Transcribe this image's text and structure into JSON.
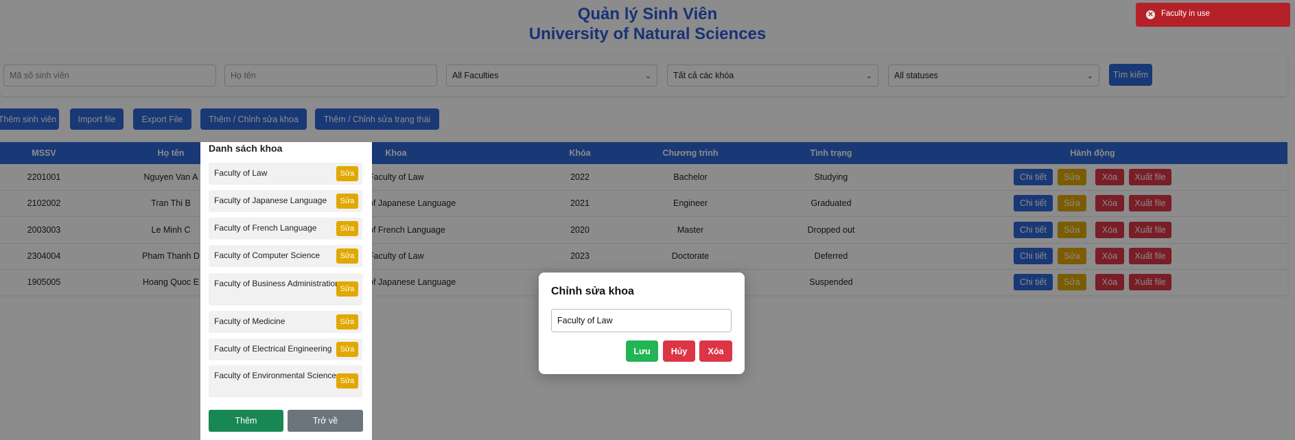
{
  "header": {
    "title_line1": "Quản lý Sinh Viên",
    "title_line2": "University of Natural Sciences"
  },
  "filters": {
    "student_id_placeholder": "Mã số sinh viên",
    "name_placeholder": "Họ tên",
    "faculty_selected": "All Faculties",
    "course_selected": "Tất cả các khóa",
    "status_selected": "All statuses",
    "search_label": "Tìm kiếm"
  },
  "toolbar": {
    "add_student": "Thêm sinh viên",
    "import_file": "Import file",
    "export_file": "Export File",
    "edit_faculty": "Thêm / Chỉnh sửa khoa",
    "edit_status": "Thêm / Chỉnh sửa trạng thái"
  },
  "table": {
    "headers": {
      "mssv": "MSSV",
      "name": "Họ tên",
      "faculty": "Khoa",
      "course": "Khóa",
      "program": "Chương trình",
      "status": "Tình trạng",
      "actions": "Hành động"
    },
    "action_labels": {
      "detail": "Chi tiết",
      "edit": "Sửa",
      "delete": "Xóa",
      "export": "Xuất file"
    },
    "rows": [
      {
        "mssv": "2201001",
        "name": "Nguyen Van A",
        "faculty": "Faculty of Law",
        "course": "2022",
        "program": "Bachelor",
        "status": "Studying"
      },
      {
        "mssv": "2102002",
        "name": "Tran Thi B",
        "faculty": "of Japanese Language",
        "course": "2021",
        "program": "Engineer",
        "status": "Graduated"
      },
      {
        "mssv": "2003003",
        "name": "Le Minh C",
        "faculty": "of French Language",
        "course": "2020",
        "program": "Master",
        "status": "Dropped out"
      },
      {
        "mssv": "2304004",
        "name": "Pham Thanh D",
        "faculty": "Faculty of Law",
        "course": "2023",
        "program": "Doctorate",
        "status": "Deferred"
      },
      {
        "mssv": "1905005",
        "name": "Hoang Quoc E",
        "faculty": "of Japanese Language",
        "course": "",
        "program": "",
        "status": "Suspended"
      }
    ]
  },
  "faculty_panel": {
    "title": "Danh sách khoa",
    "edit_label": "Sửa",
    "items": [
      "Faculty of Law",
      "Faculty of Japanese Language",
      "Faculty of French Language",
      "Faculty of Computer Science",
      "Faculty of Business Administration",
      "Faculty of Medicine",
      "Faculty of Electrical Engineering",
      "Faculty of Environmental Science"
    ],
    "add_label": "Thêm",
    "back_label": "Trở về"
  },
  "modal": {
    "title": "Chỉnh sửa khoa",
    "input_value": "Faculty of Law",
    "save_label": "Lưu",
    "cancel_label": "Hủy",
    "delete_label": "Xóa"
  },
  "toast": {
    "message": "Faculty in use"
  },
  "colors": {
    "primary": "#2f66d8",
    "warning": "#e0a800",
    "danger": "#dc3545",
    "success": "#22b455",
    "toast": "#b52128"
  }
}
